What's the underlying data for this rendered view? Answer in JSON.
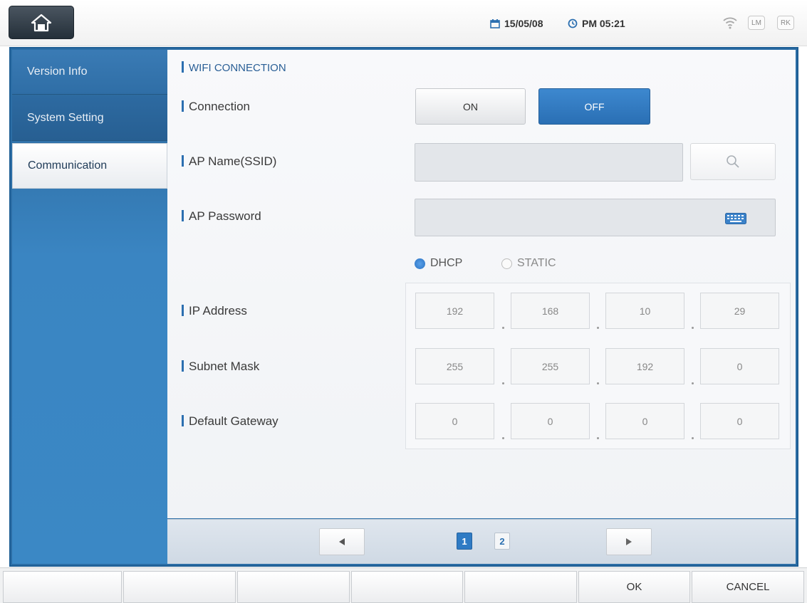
{
  "topbar": {
    "home_icon": "home-icon",
    "date": "15/05/08",
    "time": "PM 05:21",
    "wifi_icon": "wifi-icon",
    "badge_lm": "LM",
    "badge_rk": "RK"
  },
  "sidebar": {
    "items": [
      {
        "label": "Version Info"
      },
      {
        "label": "System Setting"
      },
      {
        "label": "Communication"
      }
    ]
  },
  "main": {
    "section_title": "WIFI CONNECTION",
    "connection_label": "Connection",
    "on_label": "ON",
    "off_label": "OFF",
    "ssid_label": "AP Name(SSID)",
    "ssid_value": "",
    "password_label": "AP Password",
    "password_value": "",
    "dhcp_label": "DHCP",
    "static_label": "STATIC",
    "ip_label": "IP Address",
    "subnet_label": "Subnet Mask",
    "gateway_label": "Default Gateway",
    "ip": [
      "192",
      "168",
      "10",
      "29"
    ],
    "subnet": [
      "255",
      "255",
      "192",
      "0"
    ],
    "gateway": [
      "0",
      "0",
      "0",
      "0"
    ],
    "accent_color": "#2c6fb0"
  },
  "pager": {
    "pages": [
      "1",
      "2"
    ],
    "current": "1"
  },
  "footer": {
    "ok_label": "OK",
    "cancel_label": "CANCEL"
  }
}
